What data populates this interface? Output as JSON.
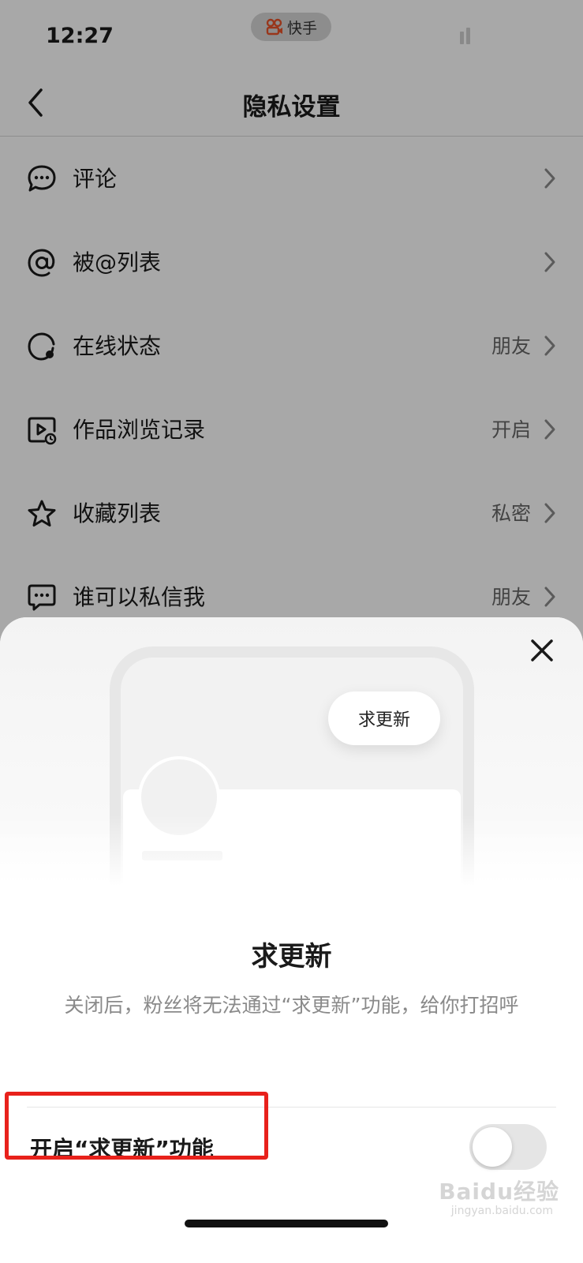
{
  "status_bar": {
    "time": "12:27",
    "app_name": "快手"
  },
  "header": {
    "title": "隐私设置"
  },
  "settings": [
    {
      "label": "评论",
      "value": "",
      "icon": "comment-icon"
    },
    {
      "label": "被@列表",
      "value": "",
      "icon": "at-icon"
    },
    {
      "label": "在线状态",
      "value": "朋友",
      "icon": "online-status-icon"
    },
    {
      "label": "作品浏览记录",
      "value": "开启",
      "icon": "video-history-icon"
    },
    {
      "label": "收藏列表",
      "value": "私密",
      "icon": "star-icon"
    },
    {
      "label": "谁可以私信我",
      "value": "朋友",
      "icon": "message-icon"
    }
  ],
  "sheet": {
    "bubble_label": "求更新",
    "title": "求更新",
    "description": "关闭后，粉丝将无法通过“求更新”功能，给你打招呼",
    "toggle_label": "开启“求更新”功能",
    "toggle_on": false
  },
  "watermark": {
    "brand": "Baidu经验",
    "url": "jingyan.baidu.com"
  },
  "colors": {
    "highlight": "#e8211b",
    "dim_overlay": "rgba(0,0,0,0.34)",
    "app_accent": "#e8532a"
  }
}
